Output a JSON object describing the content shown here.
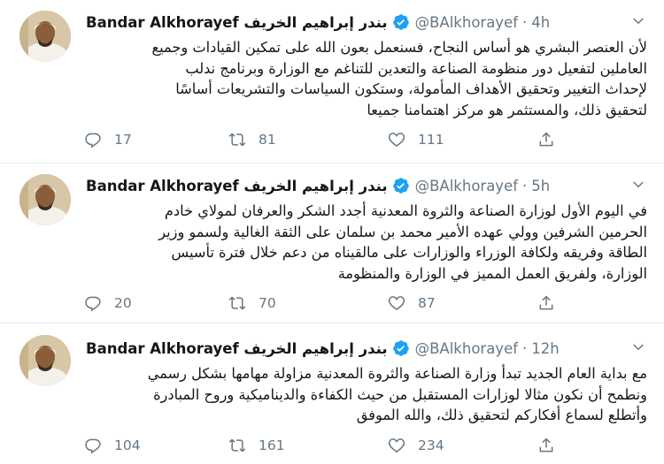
{
  "colors": {
    "text": "#14171a",
    "muted": "#657786",
    "verified": "#1da1f2",
    "divider": "#e6ecf0"
  },
  "icons": [
    "avatar",
    "verified-badge",
    "caret-down-icon",
    "reply-icon",
    "retweet-icon",
    "like-icon",
    "share-icon"
  ],
  "tweets": [
    {
      "name": "Bandar Alkhorayef بندر إبراهيم الخريف",
      "handle": "@BAlkhorayef",
      "sep": "·",
      "time": "4h",
      "lines": [
        "لأن العنصر البشري هو أساس النجاح، فسنعمل بعون الله على تمكين القيادات وجميع",
        "العاملين لتفعيل دور منظومة الصناعة والتعدين للتناغم مع الوزارة وبرنامج ندلب",
        "لإحداث التغيير وتحقيق الأهداف المأمولة، وستكون السياسات والتشريعات أساسًا",
        "لتحقيق ذلك، والمستثمر هو مركز اهتمامنا جميعا"
      ],
      "replies": "17",
      "retweets": "81",
      "likes": "111"
    },
    {
      "name": "Bandar Alkhorayef بندر إبراهيم الخريف",
      "handle": "@BAlkhorayef",
      "sep": "·",
      "time": "5h",
      "lines": [
        "في اليوم الأول لوزارة الصناعة والثروة المعدنية أجدد الشكر والعرفان لمولاي خادم",
        "الحرمين الشرفين وولي عهده الأمير محمد بن سلمان على الثقة الغالية ولسمو وزير",
        "الطاقة وفريقه ولكافة الوزراء والوزارات على مالقيناه من دعم خلال فترة تأسيس",
        "الوزارة، ولفريق العمل المميز في الوزارة والمنظومة"
      ],
      "replies": "20",
      "retweets": "70",
      "likes": "87"
    },
    {
      "name": "Bandar Alkhorayef بندر إبراهيم الخريف",
      "handle": "@BAlkhorayef",
      "sep": "·",
      "time": "12h",
      "lines": [
        "مع بداية العام الجديد تبدأ وزارة الصناعة والثروة المعدنية مزاولة مهامها بشكل رسمي",
        "ونطمح أن نكون مثالا لوزارات المستقبل من حيث الكفاءة والديناميكية وروح المبادرة",
        "وأتطلع لسماع أفكاركم لتحقيق ذلك، والله الموفق"
      ],
      "replies": "104",
      "retweets": "161",
      "likes": "234"
    }
  ]
}
